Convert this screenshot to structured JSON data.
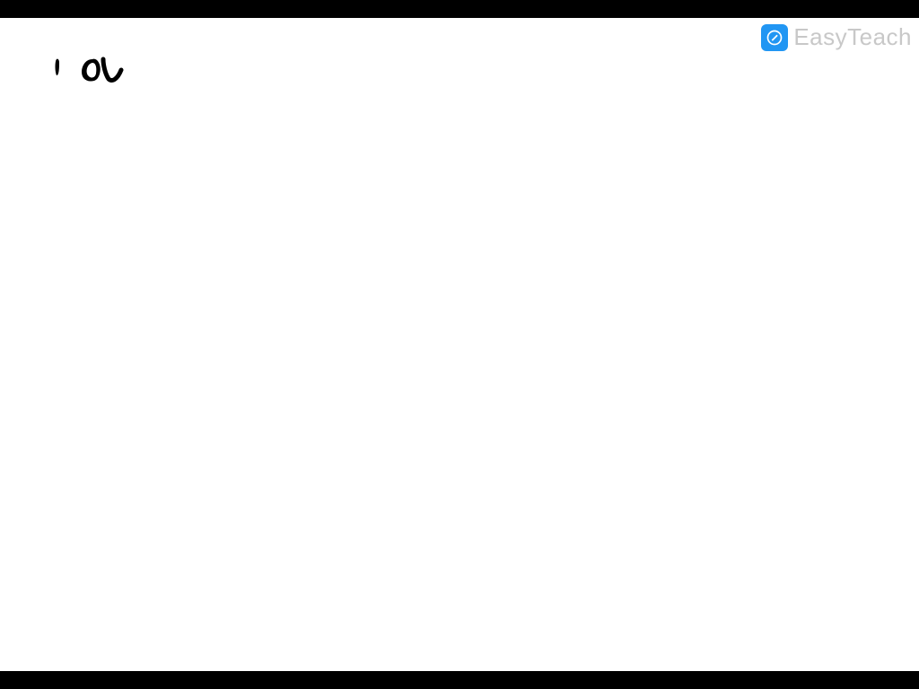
{
  "watermark": {
    "label": "EasyTeach",
    "icon_name": "pencil-circle-icon",
    "brand_color": "#2196F3"
  },
  "canvas": {
    "handwriting_svg_title": "handwritten marks (1 · ov)"
  }
}
